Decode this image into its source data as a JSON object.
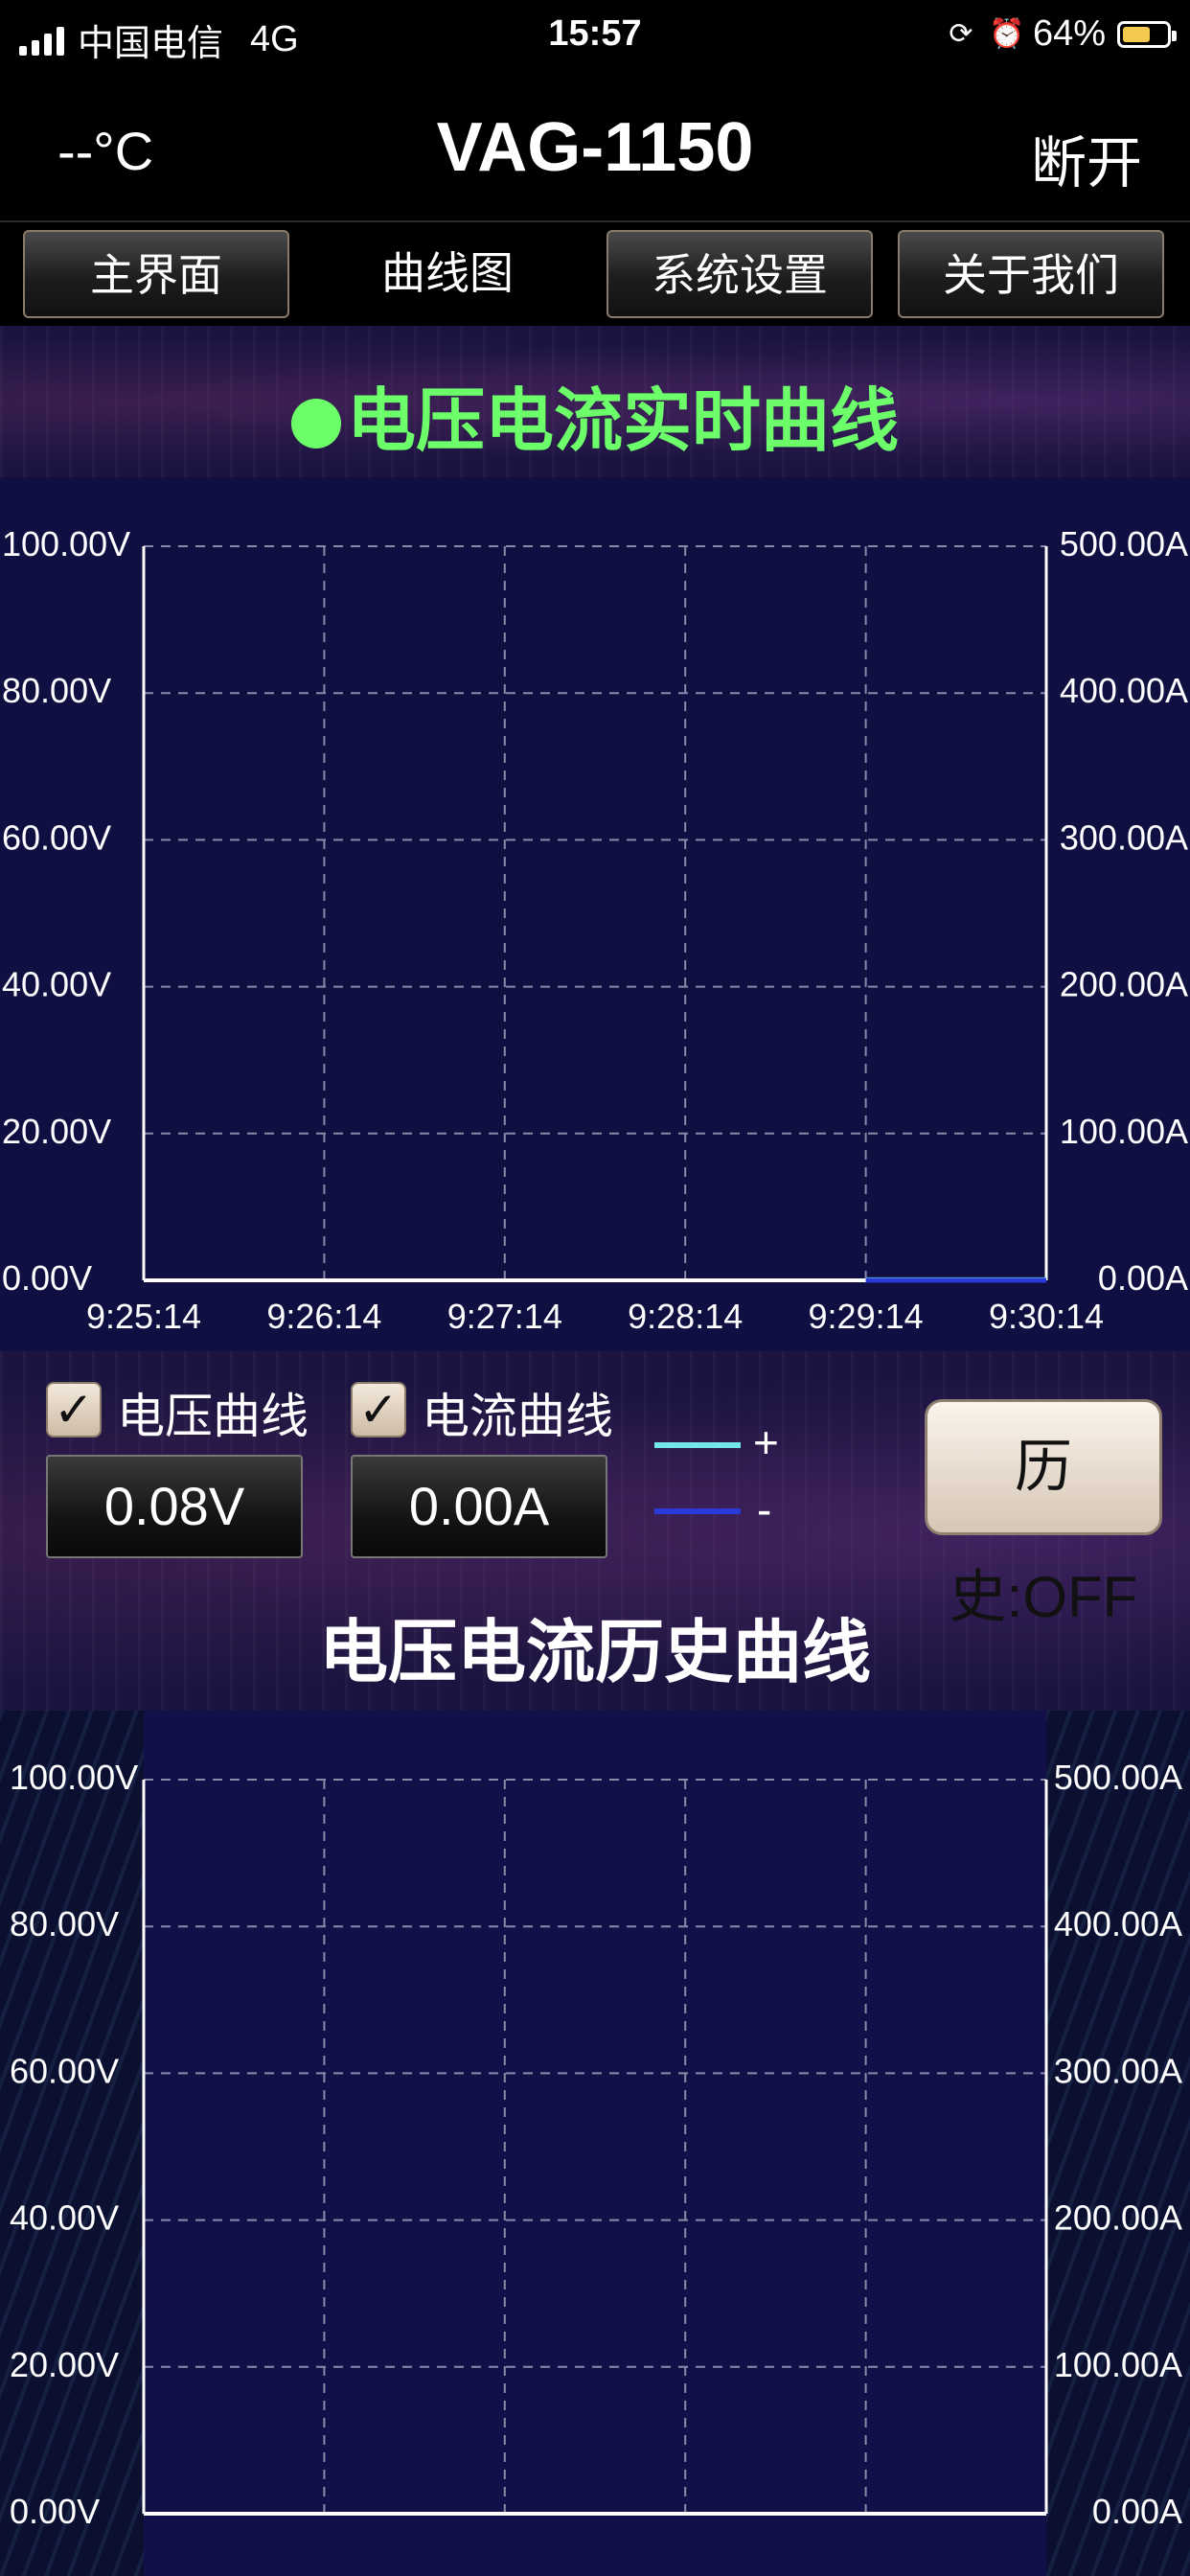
{
  "status_bar": {
    "carrier": "中国电信",
    "network": "4G",
    "time": "15:57",
    "battery": "64%",
    "battery_level": 0.64,
    "battery_color": "#f2c94c"
  },
  "header": {
    "temperature": "--°C",
    "title": "VAG-1150",
    "disconnect": "断开"
  },
  "tabs": [
    "主界面",
    "曲线图",
    "系统设置",
    "关于我们"
  ],
  "realtime": {
    "title": "电压电流实时曲线",
    "indicator_color": "#6cff6a"
  },
  "controls": {
    "voltage_checkbox_label": "电压曲线",
    "current_checkbox_label": "电流曲线",
    "voltage_value": "0.08V",
    "current_value": "0.00A",
    "legend_plus": "+",
    "legend_minus": "-",
    "legend_plus_color": "#74e8e8",
    "legend_minus_color": "#2a3ad8",
    "history_button": "历史:OFF"
  },
  "history": {
    "title": "电压电流历史曲线"
  },
  "chart_data": [
    {
      "type": "line",
      "title": "电压电流实时曲线",
      "x_ticks": [
        "9:25:14",
        "9:26:14",
        "9:27:14",
        "9:28:14",
        "9:29:14",
        "9:30:14"
      ],
      "y_left_ticks": [
        "100.00V",
        "80.00V",
        "60.00V",
        "40.00V",
        "20.00V",
        "0.00V"
      ],
      "y_right_ticks": [
        "500.00A",
        "400.00A",
        "300.00A",
        "200.00A",
        "100.00A",
        "0.00A"
      ],
      "ylim_left": [
        0,
        100
      ],
      "ylim_right": [
        0,
        500
      ],
      "grid": true,
      "series": [
        {
          "axis": "left",
          "color": "#74e8e8",
          "x": [
            "9:29:14",
            "9:30:14"
          ],
          "values": [
            0.08,
            0.08
          ]
        },
        {
          "axis": "right",
          "color": "#2a3ad8",
          "x": [
            "9:29:14",
            "9:30:14"
          ],
          "values": [
            0.0,
            0.0
          ]
        }
      ]
    },
    {
      "type": "line",
      "title": "电压电流历史曲线",
      "y_left_ticks": [
        "100.00V",
        "80.00V",
        "60.00V",
        "40.00V",
        "20.00V",
        "0.00V"
      ],
      "y_right_ticks": [
        "500.00A",
        "400.00A",
        "300.00A",
        "200.00A",
        "100.00A",
        "0.00A"
      ],
      "ylim_left": [
        0,
        100
      ],
      "ylim_right": [
        0,
        500
      ],
      "grid": true,
      "series": []
    }
  ]
}
